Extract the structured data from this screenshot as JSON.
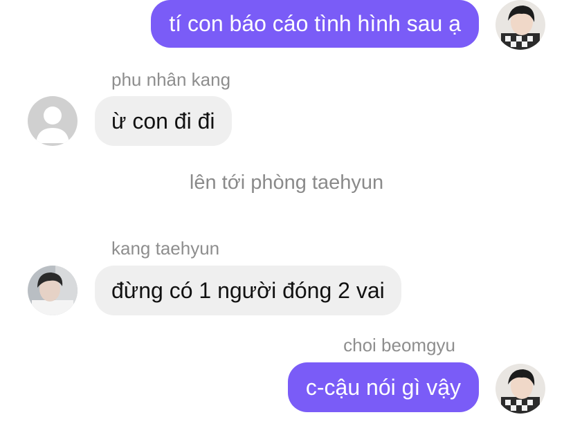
{
  "messages": [
    {
      "text": "tí con báo cáo tình hình sau ạ"
    },
    {
      "sender": "phu nhân kang",
      "text": "ừ con đi đi"
    },
    {
      "text": "lên tới phòng taehyun"
    },
    {
      "sender": "kang taehyun",
      "text": "đừng có 1 người đóng 2 vai"
    },
    {
      "sender": "choi beomgyu",
      "text": "c-cậu nói gì vậy"
    }
  ],
  "colors": {
    "outgoing_bubble": "#7a5cf7",
    "incoming_bubble": "#efefef",
    "sender_name": "#8e8e8e",
    "system_text": "#8a8a8a"
  },
  "icons": {
    "default_avatar": "person-silhouette-icon"
  }
}
